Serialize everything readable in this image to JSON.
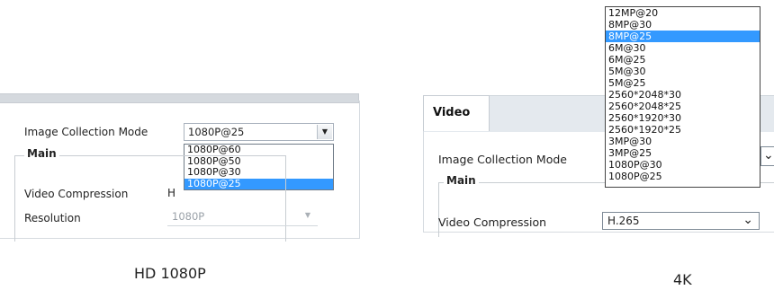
{
  "left": {
    "image_collection_mode_label": "Image Collection Mode",
    "image_collection_mode_value": "1080P@25",
    "image_collection_mode_options": [
      "1080P@60",
      "1080P@50",
      "1080P@30",
      "1080P@25"
    ],
    "image_collection_mode_selected_index": 3,
    "main_group_title": "Main",
    "video_compression_label": "Video Compression",
    "video_compression_value": "H",
    "resolution_label": "Resolution",
    "resolution_value": "1080P",
    "caption": "HD 1080P"
  },
  "right": {
    "tab_label": "Video",
    "image_collection_mode_label": "Image Collection Mode",
    "image_collection_mode_options": [
      "12MP@20",
      "8MP@30",
      "8MP@25",
      "6M@30",
      "6M@25",
      "5M@30",
      "5M@25",
      "2560*2048*30",
      "2560*2048*25",
      "2560*1920*30",
      "2560*1920*25",
      "3MP@30",
      "3MP@25",
      "1080P@30",
      "1080P@25"
    ],
    "image_collection_mode_selected_index": 2,
    "main_group_title": "Main",
    "video_compression_label": "Video Compression",
    "video_compression_value": "H.265",
    "caption": "4K"
  },
  "colors": {
    "selection": "#3399ff",
    "tab_bar": "#e4e9ee"
  }
}
